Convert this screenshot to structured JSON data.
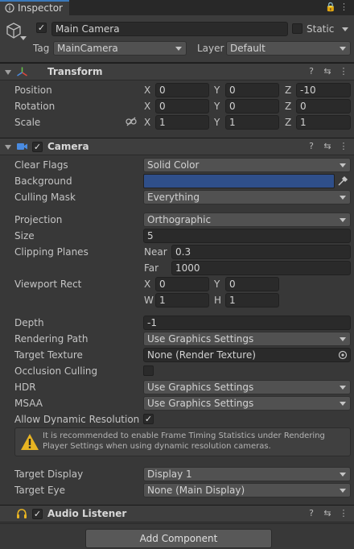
{
  "tab": {
    "title": "Inspector"
  },
  "gameobject": {
    "name": "Main Camera",
    "static_label": "Static",
    "tag_label": "Tag",
    "tag_value": "MainCamera",
    "layer_label": "Layer",
    "layer_value": "Default"
  },
  "transform": {
    "title": "Transform",
    "position": {
      "label": "Position",
      "x": "0",
      "y": "0",
      "z": "-10"
    },
    "rotation": {
      "label": "Rotation",
      "x": "0",
      "y": "0",
      "z": "0"
    },
    "scale": {
      "label": "Scale",
      "x": "1",
      "y": "1",
      "z": "1"
    },
    "axis": {
      "x": "X",
      "y": "Y",
      "z": "Z"
    }
  },
  "camera": {
    "title": "Camera",
    "clear_flags": {
      "label": "Clear Flags",
      "value": "Solid Color"
    },
    "background": {
      "label": "Background",
      "color": "#2f4f8a"
    },
    "culling_mask": {
      "label": "Culling Mask",
      "value": "Everything"
    },
    "projection": {
      "label": "Projection",
      "value": "Orthographic"
    },
    "size": {
      "label": "Size",
      "value": "5"
    },
    "clipping": {
      "label": "Clipping Planes",
      "near_label": "Near",
      "near": "0.3",
      "far_label": "Far",
      "far": "1000"
    },
    "viewport": {
      "label": "Viewport Rect",
      "x_label": "X",
      "x": "0",
      "y_label": "Y",
      "y": "0",
      "w_label": "W",
      "w": "1",
      "h_label": "H",
      "h": "1"
    },
    "depth": {
      "label": "Depth",
      "value": "-1"
    },
    "rendering_path": {
      "label": "Rendering Path",
      "value": "Use Graphics Settings"
    },
    "target_texture": {
      "label": "Target Texture",
      "value": "None (Render Texture)"
    },
    "occlusion_culling": {
      "label": "Occlusion Culling"
    },
    "hdr": {
      "label": "HDR",
      "value": "Use Graphics Settings"
    },
    "msaa": {
      "label": "MSAA",
      "value": "Use Graphics Settings"
    },
    "dynamic_res": {
      "label": "Allow Dynamic Resolution"
    },
    "warning": "It is recommended to enable Frame Timing Statistics under Rendering Player Settings when using dynamic resolution cameras.",
    "target_display": {
      "label": "Target Display",
      "value": "Display 1"
    },
    "target_eye": {
      "label": "Target Eye",
      "value": "None (Main Display)"
    }
  },
  "audio_listener": {
    "title": "Audio Listener"
  },
  "add_component": "Add Component",
  "colors": {
    "accent": "#3a79bb",
    "warning": "#e8b422"
  }
}
